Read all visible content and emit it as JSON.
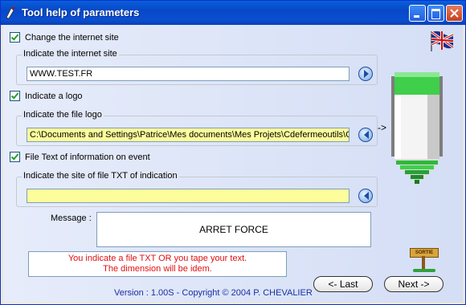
{
  "window": {
    "title": "Tool help of parameters"
  },
  "internet": {
    "checkbox_label": "Change the internet site",
    "group_label": "Indicate the internet site",
    "value": "WWW.TEST.FR"
  },
  "logo": {
    "checkbox_label": "Indicate a logo",
    "group_label": "Indicate the file logo",
    "value": "C:\\Documents and Settings\\Patrice\\Mes documents\\Mes Projets\\Cdefermeoutils\\Cu"
  },
  "textfile": {
    "checkbox_label": "File Text of information on event",
    "group_label": "Indicate the site of file TXT of indication",
    "value": ""
  },
  "message": {
    "label": "Message :",
    "value": "ARRET FORCE"
  },
  "warning": {
    "line1": "You indicate a file TXT OR you tape your text.",
    "line2": "The dimension will be idem."
  },
  "version": "Version : 1.00S - Copyright © 2004 P. CHEVALIER",
  "exit_sign": "SORTIE",
  "arrow_glyph": "->",
  "buttons": {
    "last": "<-  Last",
    "next": "Next  ->"
  },
  "colors": {
    "title_bar": "#0a5fd8",
    "field_highlight": "#fdfd9b",
    "warning_text": "#e01010",
    "version_text": "#1a30a0"
  }
}
